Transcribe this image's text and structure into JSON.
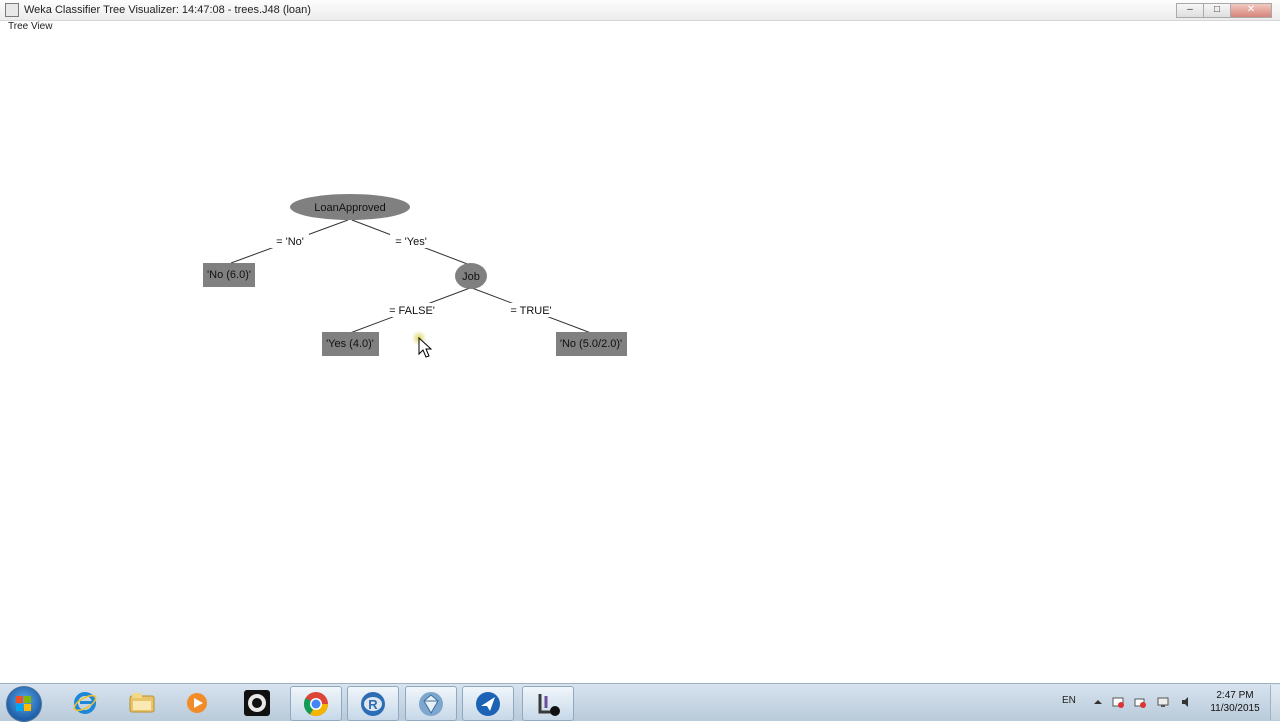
{
  "window": {
    "title": "Weka Classifier Tree Visualizer: 14:47:08 - trees.J48 (loan)",
    "controls": {
      "minimize": "–",
      "maximize": "□",
      "close": "✕"
    }
  },
  "menu": {
    "tree_view": "Tree View"
  },
  "tree": {
    "root": {
      "label": "LoanApproved",
      "shape": "ellipse"
    },
    "nodes": {
      "job": {
        "label": "Job",
        "shape": "ellipse"
      },
      "leaf_no": {
        "label": "'No (6.0)'",
        "shape": "box"
      },
      "leaf_yes": {
        "label": "'Yes (4.0)'",
        "shape": "box"
      },
      "leaf_no2": {
        "label": "'No (5.0/2.0)'",
        "shape": "box"
      }
    },
    "edges": {
      "root_no": "= 'No'",
      "root_yes": "= 'Yes'",
      "job_false": "= FALSE'",
      "job_true": "= TRUE'"
    },
    "colors": {
      "node_fill": "#808080",
      "edge": "#333333"
    }
  },
  "taskbar": {
    "apps": [
      {
        "name": "internet-explorer",
        "icon": "ie-icon"
      },
      {
        "name": "file-explorer",
        "icon": "folder-icon"
      },
      {
        "name": "media-player",
        "icon": "media-player-icon"
      },
      {
        "name": "obs",
        "icon": "obs-icon"
      },
      {
        "name": "chrome",
        "icon": "chrome-icon"
      },
      {
        "name": "r",
        "icon": "r-icon"
      },
      {
        "name": "rapidminer",
        "icon": "rapidminer-icon"
      },
      {
        "name": "arrow-app",
        "icon": "arrow-app-icon"
      },
      {
        "name": "weka",
        "icon": "weka-icon"
      }
    ],
    "language": "EN",
    "time": "2:47 PM",
    "date": "11/30/2015"
  }
}
